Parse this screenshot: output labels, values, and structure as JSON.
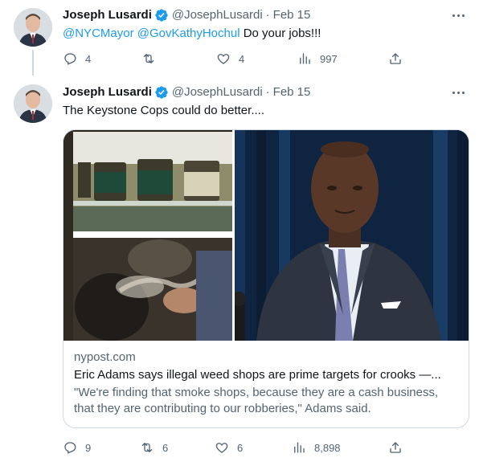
{
  "tweets": [
    {
      "author_name": "Joseph Lusardi",
      "handle": "@JosephLusardi",
      "separator": "·",
      "date": "Feb 15",
      "mentions": [
        "@NYCMayor",
        "@GovKathyHochul"
      ],
      "text": "Do your jobs!!!",
      "replies": "4",
      "retweets": "",
      "likes": "4",
      "views": "997"
    },
    {
      "author_name": "Joseph Lusardi",
      "handle": "@JosephLusardi",
      "separator": "·",
      "date": "Feb 15",
      "text": "The Keystone Cops could do better....",
      "card": {
        "domain": "nypost.com",
        "title": "Eric Adams says illegal weed shops are prime targets for crooks —...",
        "description": "\"We're finding that smoke shops, because they are a cash business, that they are contributing to our robberies,\" Adams said."
      },
      "replies": "9",
      "retweets": "6",
      "likes": "6",
      "views": "8,898"
    }
  ],
  "colors": {
    "accent": "#1d9bf0",
    "secondary_text": "#536471",
    "primary_text": "#0f1419",
    "border": "#cfd9de"
  },
  "icons": [
    "verified-badge-icon",
    "more-icon",
    "reply-icon",
    "retweet-icon",
    "like-icon",
    "views-icon",
    "share-icon"
  ]
}
